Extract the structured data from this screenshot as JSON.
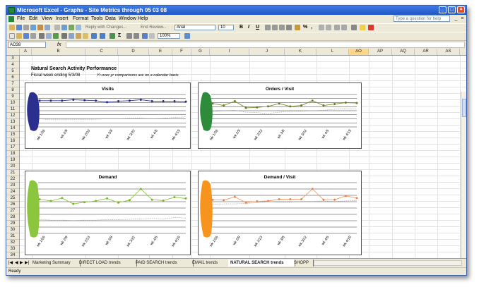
{
  "window": {
    "title": "Microsoft Excel - Graphs - Site Metrics through 05 03 08"
  },
  "menu": [
    "File",
    "Edit",
    "View",
    "Insert",
    "Format",
    "Tools",
    "Data",
    "Window",
    "Help"
  ],
  "help_box": {
    "placeholder": "Type a question for help"
  },
  "toolbar": {
    "reply_changes": "Reply with Changes...",
    "end_review": "End Review...",
    "font_name": "Arial",
    "font_size": "10",
    "bold": "B",
    "italic": "I",
    "underline": "U",
    "percent": "%",
    "comma": ",",
    "zoom": "100%",
    "sigma": "Σ"
  },
  "formula_bar": {
    "name_box": "AO38",
    "fx": "fx",
    "content": ""
  },
  "columns": [
    "A",
    "B",
    "C",
    "D",
    "E",
    "F",
    "G",
    "I",
    "J",
    "K",
    "L",
    "AO",
    "AP",
    "AQ",
    "AR",
    "AS"
  ],
  "active_column": "AO",
  "rows": [
    "3",
    "4",
    "5",
    "6",
    "7",
    "8",
    "9",
    "10",
    "11",
    "12",
    "13",
    "14",
    "15",
    "16",
    "17",
    "18",
    "19",
    "20",
    "21",
    "22",
    "23",
    "24",
    "25",
    "26",
    "27",
    "28",
    "29",
    "30",
    "31",
    "32",
    "33",
    "34",
    "35",
    "36"
  ],
  "sheet": {
    "title": "Natural Search Activity Performance",
    "subtitle": "Fiscal week ending 5/3/08",
    "note": "Yr-over-yr comparisons are on a calendar basis"
  },
  "chart_data": [
    {
      "type": "line",
      "title": "Visits",
      "categories": [
        "wk 1/26",
        "wk 2/9",
        "wk 2/23",
        "wk 3/8",
        "wk 3/22",
        "wk 4/5",
        "wk 4/19",
        "wk 5/3"
      ],
      "x": [
        1,
        2,
        3,
        4,
        5,
        6,
        7,
        8,
        9,
        10,
        11,
        12,
        13,
        14
      ],
      "series": [
        {
          "values": [
            10.3,
            10.3,
            10.3,
            10.1,
            10.2,
            10.3,
            10.6,
            10.4,
            10.3,
            10.1,
            10.4,
            10.4,
            10.4,
            10.5
          ]
        },
        {
          "values": [
            14.1,
            14.3,
            14.3,
            14.3,
            14.2,
            14.2,
            14.1,
            14.1,
            14.0,
            14.0,
            14.1,
            14.0,
            13.8,
            13.7
          ]
        }
      ],
      "ylim": [
        9,
        15.8
      ],
      "grid": true,
      "colors": {
        "primary": "#2b3394",
        "secondary": "#9a9a9a",
        "marker": "#202a80"
      }
    },
    {
      "type": "line",
      "title": "Orders / Visit",
      "categories": [
        "wk 1/26",
        "wk 2/9",
        "wk 2/23",
        "wk 3/8",
        "wk 3/22",
        "wk 4/5",
        "wk 4/19",
        "wk 5/3"
      ],
      "x": [
        1,
        2,
        3,
        4,
        5,
        6,
        7,
        8,
        9,
        10,
        11,
        12,
        13,
        14
      ],
      "series": [
        {
          "values": [
            10.9,
            11.3,
            10.4,
            11.8,
            11.7,
            11.5,
            10.9,
            11.5,
            11.3,
            10.3,
            11.3,
            11.0,
            10.7,
            10.8
          ]
        },
        {
          "values": [
            12.6,
            12.4,
            12.3,
            12.7,
            12.8,
            13.0,
            12.7,
            12.5,
            12.5,
            12.4,
            12.3,
            12.1,
            12.0,
            12.0
          ]
        }
      ],
      "ylim": [
        9,
        15.8
      ],
      "grid": true,
      "colors": {
        "primary": "#7d8b2a",
        "secondary": "#9a9a9a",
        "marker": "#6d7a22"
      }
    },
    {
      "type": "line",
      "title": "Demand",
      "categories": [
        "wk 1/26",
        "wk 2/9",
        "wk 2/23",
        "wk 3/8",
        "wk 3/22",
        "wk 4/5",
        "wk 4/19",
        "wk 5/3"
      ],
      "x": [
        1,
        2,
        3,
        4,
        5,
        6,
        7,
        8,
        9,
        10,
        11,
        12,
        13,
        14
      ],
      "series": [
        {
          "values": [
            26.8,
            27.2,
            26.5,
            27.9,
            27.5,
            27.2,
            26.6,
            27.6,
            27.0,
            24.3,
            26.9,
            27.1,
            26.3,
            26.6
          ]
        },
        {
          "values": [
            31.7,
            31.8,
            31.8,
            31.9,
            31.8,
            31.8,
            31.7,
            31.7,
            31.6,
            31.5,
            31.4,
            31.5,
            31.2,
            31.3
          ]
        }
      ],
      "ylim": [
        22.8,
        35.0
      ],
      "grid": true,
      "colors": {
        "primary": "#8bc53f",
        "secondary": "#9a9a9a",
        "marker": "#7ab334"
      }
    },
    {
      "type": "line",
      "title": "Demand / Visit",
      "categories": [
        "wk 1/26",
        "wk 2/9",
        "wk 2/23",
        "wk 3/8",
        "wk 3/22",
        "wk 4/5",
        "wk 4/19",
        "wk 5/3"
      ],
      "x": [
        1,
        2,
        3,
        4,
        5,
        6,
        7,
        8,
        9,
        10,
        11,
        12,
        13,
        14
      ],
      "series": [
        {
          "values": [
            26.9,
            27.0,
            26.2,
            27.6,
            27.3,
            27.2,
            26.8,
            26.8,
            26.8,
            24.3,
            26.9,
            26.9,
            26.0,
            26.5
          ]
        },
        {
          "values": [
            28.0,
            27.9,
            27.9,
            27.8,
            27.6,
            27.4,
            27.5,
            27.5,
            27.3,
            27.3,
            27.2,
            27.3,
            27.2,
            27.1
          ]
        }
      ],
      "ylim": [
        22.8,
        35.0
      ],
      "grid": true,
      "colors": {
        "primary": "#f59a66",
        "secondary": "#9a9a9a",
        "marker": "#e88450"
      }
    }
  ],
  "blob_colors": [
    "#2b2f8f",
    "#2e8b3a",
    "#8cc63f",
    "#f7941d"
  ],
  "tabs": {
    "items": [
      "Marketing Summary",
      "DIRECT LOAD trends",
      "PAID SEARCH trends",
      "EMAIL trends",
      "NATURAL SEARCH trends",
      "SHOPP"
    ],
    "active_index": 4
  },
  "status": {
    "text": "Ready"
  }
}
